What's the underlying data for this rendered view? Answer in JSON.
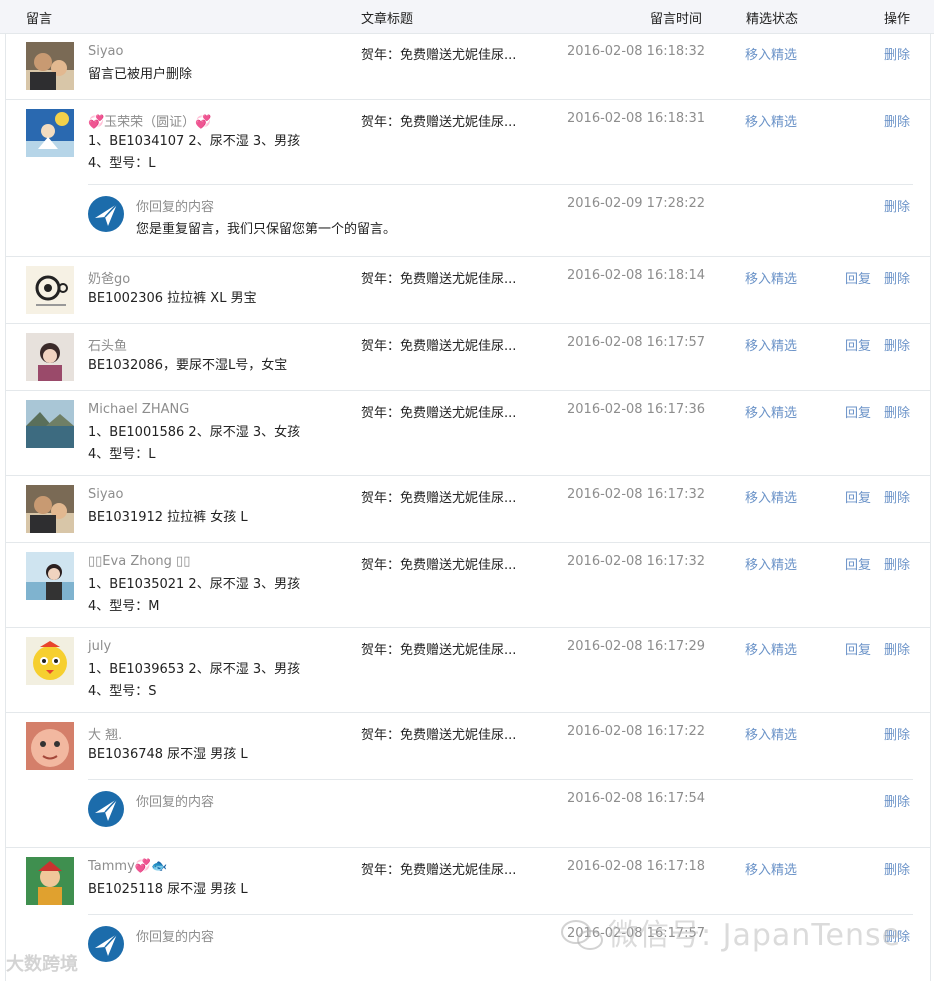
{
  "header": {
    "col_message": "留言",
    "col_article": "文章标题",
    "col_time": "留言时间",
    "col_featured": "精选状态",
    "col_action": "操作"
  },
  "actions": {
    "featured": "移入精选",
    "reply": "回复",
    "delete": "删除"
  },
  "rows": [
    {
      "nick": "Siyao",
      "content": "留言已被用户删除",
      "article": "贺年：免费赠送尤妮佳尿...",
      "time": "2016-02-08 16:18:32",
      "has_reply_btn": false
    },
    {
      "nick": "💞玉荣荣（圆证）💞",
      "content": "1、BE1034107 2、尿不湿 3、男孩\n4、型号：L",
      "article": "贺年：免费赠送尤妮佳尿...",
      "time": "2016-02-08 16:18:31",
      "has_reply_btn": false,
      "reply": {
        "label": "你回复的内容",
        "text": "您是重复留言，我们只保留您第一个的留言。",
        "time": "2016-02-09 17:28:22"
      }
    },
    {
      "nick": "奶爸go",
      "content": "BE1002306 拉拉裤 XL 男宝",
      "article": "贺年：免费赠送尤妮佳尿...",
      "time": "2016-02-08 16:18:14",
      "has_reply_btn": true
    },
    {
      "nick": "石头鱼",
      "content": "BE1032086，要尿不湿L号，女宝",
      "article": "贺年：免费赠送尤妮佳尿...",
      "time": "2016-02-08 16:17:57",
      "has_reply_btn": true
    },
    {
      "nick": "Michael ZHANG",
      "content": "1、BE1001586 2、尿不湿 3、女孩\n4、型号：L",
      "article": "贺年：免费赠送尤妮佳尿...",
      "time": "2016-02-08 16:17:36",
      "has_reply_btn": true
    },
    {
      "nick": "Siyao",
      "content": "BE1031912 拉拉裤 女孩 L",
      "article": "贺年：免费赠送尤妮佳尿...",
      "time": "2016-02-08 16:17:32",
      "has_reply_btn": true
    },
    {
      "nick": "▯▯Eva Zhong ▯▯",
      "content": "1、BE1035021 2、尿不湿 3、男孩\n4、型号：M",
      "article": "贺年：免费赠送尤妮佳尿...",
      "time": "2016-02-08 16:17:32",
      "has_reply_btn": true
    },
    {
      "nick": "july",
      "content": "1、BE1039653 2、尿不湿 3、男孩\n4、型号：S",
      "article": "贺年：免费赠送尤妮佳尿...",
      "time": "2016-02-08 16:17:29",
      "has_reply_btn": true
    },
    {
      "nick": "大 翘.",
      "content": "BE1036748 尿不湿 男孩 L",
      "article": "贺年：免费赠送尤妮佳尿...",
      "time": "2016-02-08 16:17:22",
      "has_reply_btn": false,
      "reply": {
        "label": "你回复的内容",
        "text": "",
        "time": "2016-02-08 16:17:54"
      }
    },
    {
      "nick": "Tammy💞🐟",
      "content": "BE1025118 尿不湿 男孩 L",
      "article": "贺年：免费赠送尤妮佳尿...",
      "time": "2016-02-08 16:17:18",
      "has_reply_btn": false,
      "reply": {
        "label": "你回复的内容",
        "text": "",
        "time": "2016-02-08 16:17:57"
      }
    }
  ],
  "watermark": "微信号: JapanTense",
  "logo": "大数跨境",
  "colors": {
    "link": "#6b93c8",
    "header_bg": "#f4f5f9",
    "border": "#e4e8eb",
    "muted": "#8d8d8d"
  }
}
